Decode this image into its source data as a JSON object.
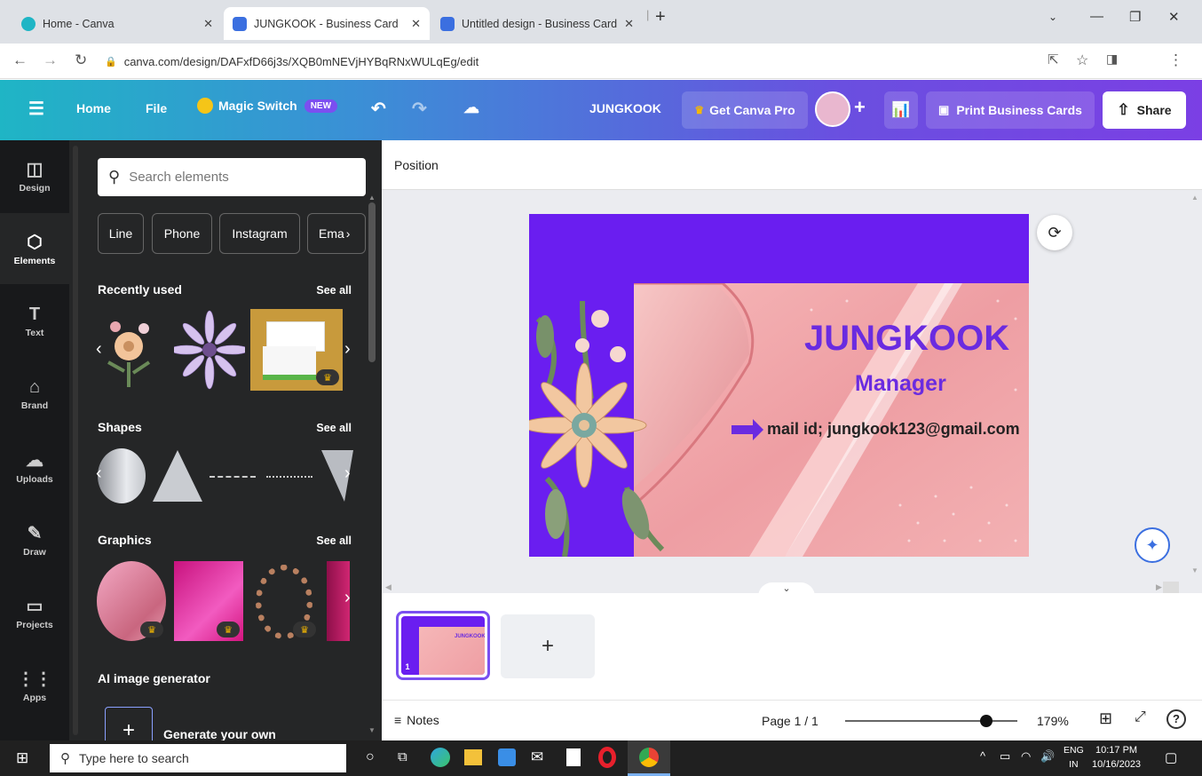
{
  "browser": {
    "tabs": [
      {
        "title": "Home - Canva",
        "active": false
      },
      {
        "title": "JUNGKOOK - Business Card",
        "active": true
      },
      {
        "title": "Untitled design - Business Card",
        "active": false
      }
    ],
    "url": "canva.com/design/DAFxfD66j3s/XQB0mNEVjHYBqRNxWULqEg/edit"
  },
  "topbar": {
    "home": "Home",
    "file": "File",
    "magic_switch": "Magic Switch",
    "new_badge": "NEW",
    "design_title": "JUNGKOOK",
    "get_pro": "Get Canva Pro",
    "print": "Print Business Cards",
    "share": "Share"
  },
  "rail": [
    {
      "label": "Design",
      "icon": "design-icon"
    },
    {
      "label": "Elements",
      "icon": "elements-icon"
    },
    {
      "label": "Text",
      "icon": "text-icon"
    },
    {
      "label": "Brand",
      "icon": "brand-icon"
    },
    {
      "label": "Uploads",
      "icon": "uploads-icon"
    },
    {
      "label": "Draw",
      "icon": "draw-icon"
    },
    {
      "label": "Projects",
      "icon": "projects-icon"
    },
    {
      "label": "Apps",
      "icon": "apps-icon"
    }
  ],
  "panel": {
    "search_placeholder": "Search elements",
    "chips": [
      "Line",
      "Phone",
      "Instagram",
      "Ema"
    ],
    "recently_used": "Recently used",
    "shapes": "Shapes",
    "graphics": "Graphics",
    "see_all": "See all",
    "ai_title": "AI image generator",
    "generate": "Generate your own"
  },
  "workspace": {
    "position": "Position",
    "card": {
      "name": "JUNGKOOK",
      "role": "Manager",
      "email": "mail id; jungkook123@gmail.com"
    },
    "thumb_number": "1",
    "notes": "Notes",
    "page": "Page 1 / 1",
    "zoom": "179%",
    "zoom_level": 0.82
  },
  "taskbar": {
    "search": "Type here to search",
    "lang": "ENG",
    "region": "IN",
    "time": "10:17 PM",
    "date": "10/16/2023"
  },
  "colors": {
    "card_purple": "#6a1ef0",
    "text_purple": "#6a2be0",
    "pro_crown": "#f5b800"
  }
}
